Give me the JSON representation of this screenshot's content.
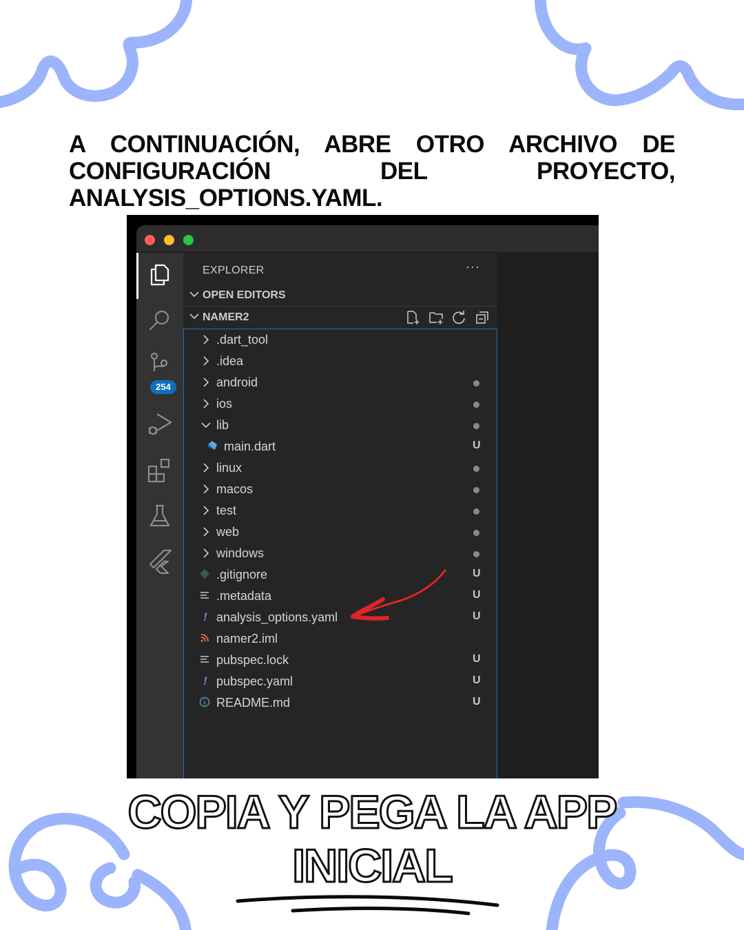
{
  "intro_text": "A CONTINUACIÓN, ABRE OTRO ARCHIVO DE CONFIGURACIÓN DEL PROYECTO, ANALYSIS_OPTIONS.YAML.",
  "headline": {
    "line1": "COPIA Y PEGA LA APP",
    "line2": "INICIAL"
  },
  "colors": {
    "accent_scribble": "#9bb4fb",
    "editor_bg": "#1e1e1e",
    "sidebar_bg": "#252526",
    "activity_bg": "#333333",
    "badge": "#0e6fc0",
    "arrow": "#e02424"
  },
  "activity_bar": {
    "icons": [
      "explorer-icon",
      "search-icon",
      "source-control-icon",
      "run-debug-icon",
      "extensions-icon",
      "testing-icon",
      "flutter-icon"
    ],
    "source_control_badge": "254"
  },
  "explorer": {
    "title": "EXPLORER",
    "more": "···",
    "open_editors_label": "OPEN EDITORS",
    "project_label": "NAMER2",
    "toolbar_icons": [
      "new-file-icon",
      "new-folder-icon",
      "refresh-icon",
      "collapse-all-icon"
    ]
  },
  "files": [
    {
      "name": ".dart_tool",
      "kind": "folder",
      "status": ""
    },
    {
      "name": ".idea",
      "kind": "folder",
      "status": ""
    },
    {
      "name": "android",
      "kind": "folder",
      "status": "dot"
    },
    {
      "name": "ios",
      "kind": "folder",
      "status": "dot"
    },
    {
      "name": "lib",
      "kind": "folder-open",
      "status": "dot"
    },
    {
      "name": "main.dart",
      "kind": "dart",
      "status": "U"
    },
    {
      "name": "linux",
      "kind": "folder",
      "status": "dot"
    },
    {
      "name": "macos",
      "kind": "folder",
      "status": "dot"
    },
    {
      "name": "test",
      "kind": "folder",
      "status": "dot"
    },
    {
      "name": "web",
      "kind": "folder",
      "status": "dot"
    },
    {
      "name": "windows",
      "kind": "folder",
      "status": "dot"
    },
    {
      "name": ".gitignore",
      "kind": "git",
      "status": "U"
    },
    {
      "name": ".metadata",
      "kind": "text",
      "status": "U"
    },
    {
      "name": "analysis_options.yaml",
      "kind": "yaml",
      "status": "U"
    },
    {
      "name": "namer2.iml",
      "kind": "rss",
      "status": ""
    },
    {
      "name": "pubspec.lock",
      "kind": "text",
      "status": "U"
    },
    {
      "name": "pubspec.yaml",
      "kind": "yaml",
      "status": "U"
    },
    {
      "name": "README.md",
      "kind": "info",
      "status": "U"
    }
  ]
}
